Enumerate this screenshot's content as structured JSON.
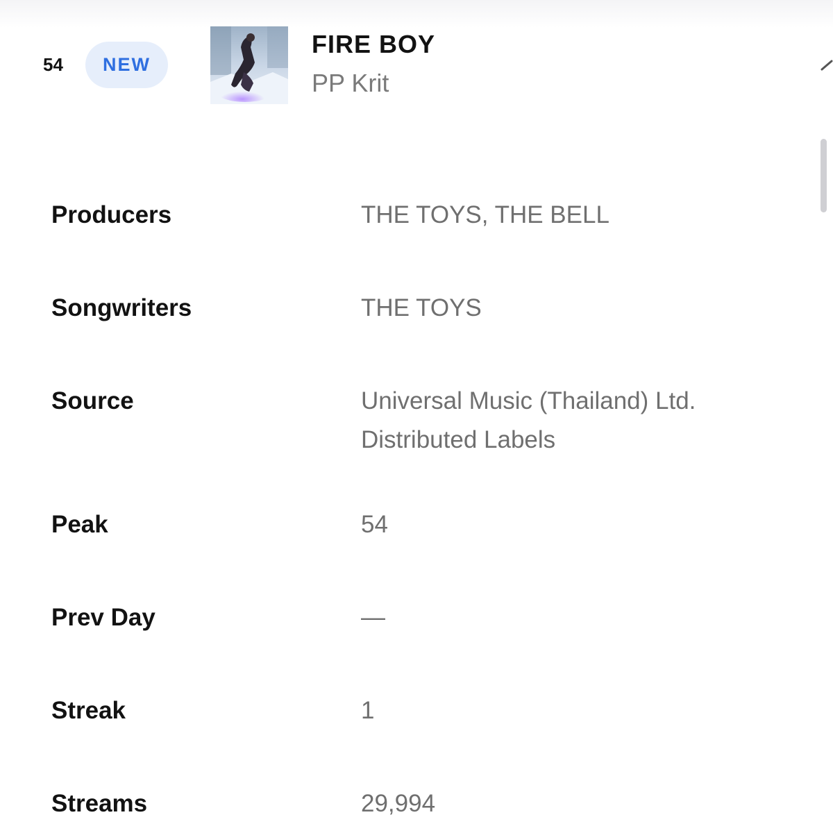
{
  "header": {
    "rank": "54",
    "badge": "NEW",
    "title": "FIRE BOY",
    "artist": "PP Krit",
    "cover_icon": "album-cover-image"
  },
  "details": {
    "producers": {
      "label": "Producers",
      "value": "THE TOYS, THE BELL"
    },
    "songwriters": {
      "label": "Songwriters",
      "value": "THE TOYS"
    },
    "source": {
      "label": "Source",
      "value_line1": "Universal Music (Thailand) Ltd.",
      "value_line2": "Distributed Labels"
    },
    "peak": {
      "label": "Peak",
      "value": "54"
    },
    "prev_day": {
      "label": "Prev Day",
      "value": "—"
    },
    "streak": {
      "label": "Streak",
      "value": "1"
    },
    "streams": {
      "label": "Streams",
      "value": "29,994"
    }
  },
  "colors": {
    "badge_bg": "#e6eefb",
    "badge_text": "#2f6fe0",
    "label_text": "#121212",
    "value_text": "#6f6f6f"
  },
  "icons": {
    "collapse": "chevron-up-icon"
  }
}
